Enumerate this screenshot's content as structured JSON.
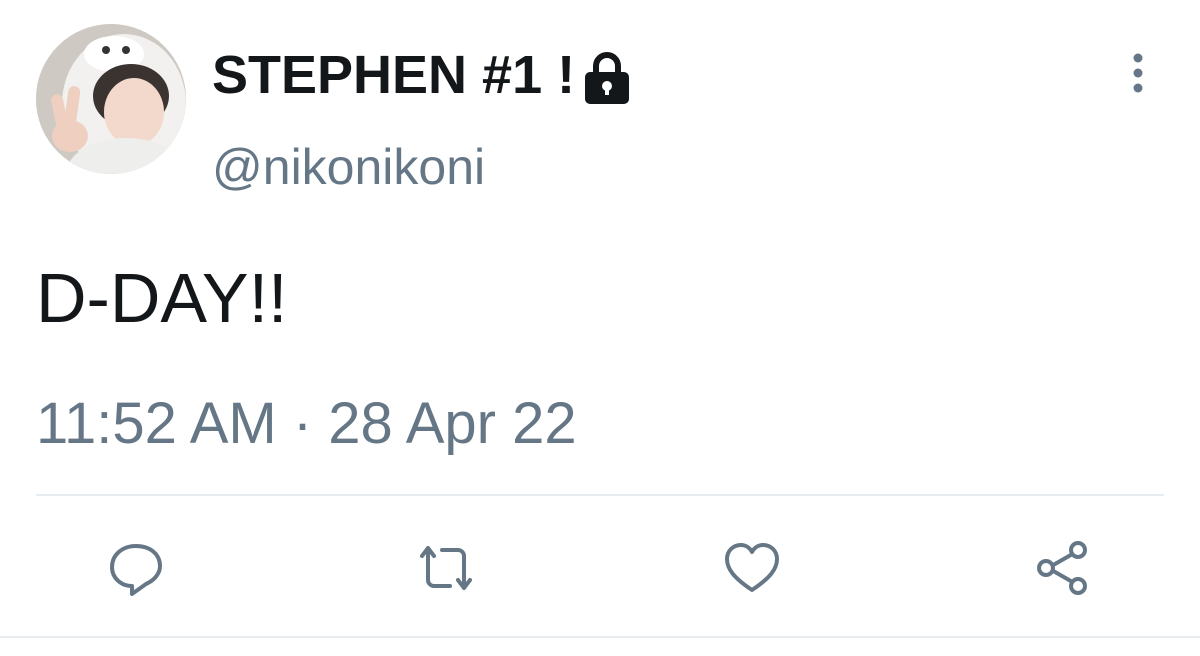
{
  "author": {
    "display_name": "STEPHEN #1 !",
    "handle": "@nikonikoni",
    "protected_icon": "lock-icon"
  },
  "tweet": {
    "text": "D-DAY!!",
    "timestamp": "11:52 AM · 28 Apr 22"
  },
  "actions": {
    "reply_icon": "reply-icon",
    "retweet_icon": "retweet-icon",
    "like_icon": "heart-icon",
    "share_icon": "share-icon",
    "more_icon": "more-vertical-icon"
  },
  "colors": {
    "text_primary": "#14171a",
    "text_secondary": "#657786",
    "divider": "#e6ecf0"
  }
}
